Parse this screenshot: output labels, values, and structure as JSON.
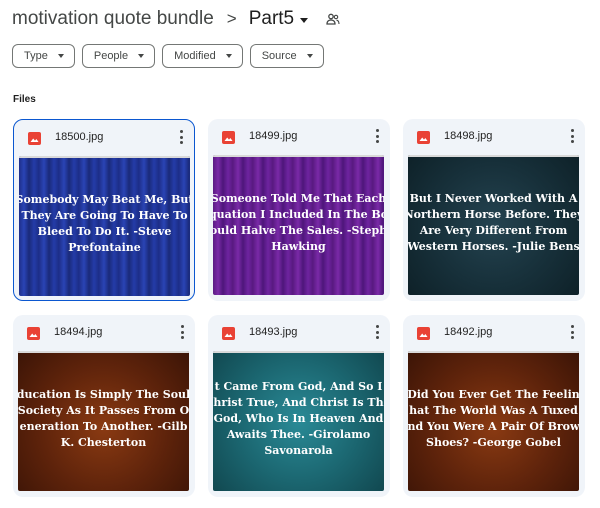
{
  "breadcrumb": {
    "root": "motivation quote bundle",
    "separator": ">",
    "current": "Part5",
    "shared_icon": "shared-folder-icon"
  },
  "filters": [
    {
      "label": "Type"
    },
    {
      "label": "People"
    },
    {
      "label": "Modified"
    },
    {
      "label": "Source"
    }
  ],
  "section": {
    "label": "Files"
  },
  "files": [
    {
      "name": "18500.jpg",
      "selected": true,
      "bg": "blue",
      "quote_lines": [
        "Somebody May Beat Me, But",
        "They Are Going To Have To",
        "Bleed To Do It. -Steve",
        "Prefontaine"
      ]
    },
    {
      "name": "18499.jpg",
      "selected": false,
      "bg": "purple",
      "quote_lines": [
        "Someone Told Me That Each",
        "quation I Included In The Bo",
        "ould Halve The Sales. -Steph",
        "Hawking"
      ]
    },
    {
      "name": "18498.jpg",
      "selected": false,
      "bg": "dark",
      "quote_lines": [
        "But I Never Worked With A",
        "Northern Horse Before. They",
        "Are Very Different From",
        "Western Horses. -Julie Bens"
      ]
    },
    {
      "name": "18494.jpg",
      "selected": false,
      "bg": "orange",
      "quote_lines": [
        "ducation Is Simply The Soul",
        "Society As It Passes From O",
        "eneration To Another. -Gilb",
        "K. Chesterton"
      ]
    },
    {
      "name": "18493.jpg",
      "selected": false,
      "bg": "teal",
      "quote_lines": [
        "t Came From God, And So I",
        "hrist True, And Christ Is Th",
        "God, Who Is In Heaven And",
        "Awaits Thee. -Girolamo",
        "Savonarola"
      ]
    },
    {
      "name": "18492.jpg",
      "selected": false,
      "bg": "orange",
      "quote_lines": [
        "Did You Ever Get The Feelin",
        "hat The World Was A Tuxed",
        "nd You Were A Pair Of Brow",
        "Shoes? -George Gobel"
      ]
    }
  ],
  "icons": {
    "file_type": "image-file-icon",
    "more": "more-options-icon"
  },
  "colors": {
    "accent": "#0b57d0",
    "image_icon": "#e94235",
    "card_bg": "#f0f4f9"
  }
}
